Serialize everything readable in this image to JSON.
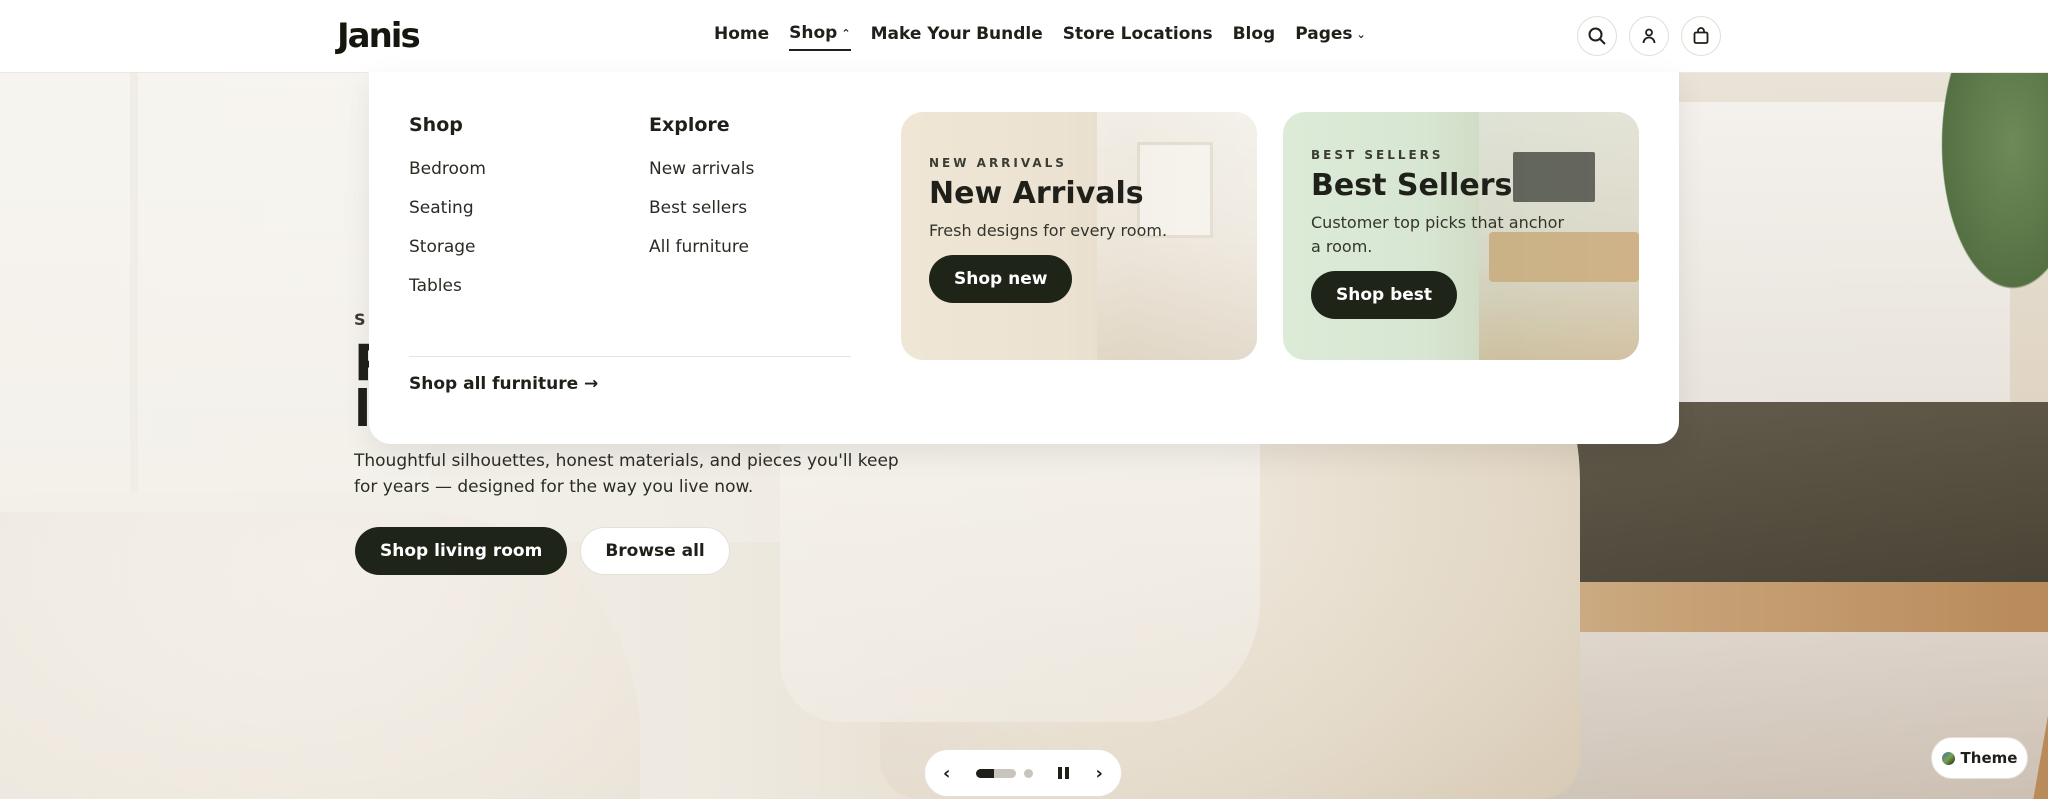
{
  "header": {
    "logo": "Janis",
    "nav": [
      {
        "label": "Home"
      },
      {
        "label": "Shop"
      },
      {
        "label": "Make Your Bundle"
      },
      {
        "label": "Store Locations"
      },
      {
        "label": "Blog"
      },
      {
        "label": "Pages"
      }
    ],
    "icons": [
      "search-icon",
      "account-icon",
      "cart-icon"
    ]
  },
  "mega_menu": {
    "shop": {
      "heading": "Shop",
      "links": [
        "Bedroom",
        "Seating",
        "Storage",
        "Tables"
      ]
    },
    "explore": {
      "heading": "Explore",
      "links": [
        "New arrivals",
        "Best sellers",
        "All furniture"
      ]
    },
    "shop_all": "Shop all furniture →",
    "promos": [
      {
        "kicker": "NEW ARRIVALS",
        "title": "New Arrivals",
        "description": "Fresh designs for every room.",
        "button": "Shop new"
      },
      {
        "kicker": "BEST SELLERS",
        "title": "Best Sellers",
        "description": "Customer top picks that anchor a room.",
        "button": "Shop best"
      }
    ]
  },
  "hero": {
    "eyebrow": "SH",
    "title_line1": "P",
    "title_line2": "li",
    "description": "Thoughtful silhouettes, honest materials, and pieces you'll keep for years — designed for the way you live now.",
    "primary_button": "Shop living room",
    "secondary_button": "Browse all"
  },
  "slider": {
    "prev": "‹",
    "next": "›",
    "slide_count": 2,
    "active_slide": 1
  },
  "theme_button": "Theme"
}
